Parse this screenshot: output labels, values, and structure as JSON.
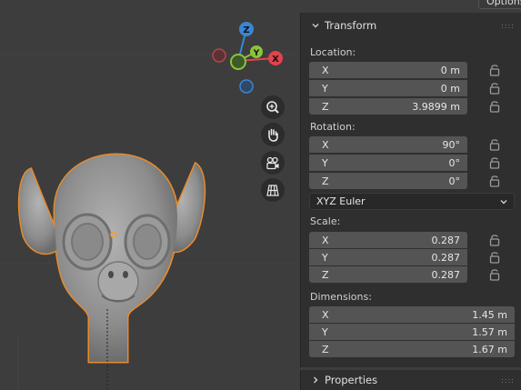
{
  "toolbar": {
    "options_label": "Options"
  },
  "gizmo": {
    "z_label": "Z",
    "y_label": "Y",
    "x_label": "X"
  },
  "viewport_tools": [
    {
      "name": "zoom-icon"
    },
    {
      "name": "hand-pan-icon"
    },
    {
      "name": "camera-icon"
    },
    {
      "name": "ortho-grid-icon"
    }
  ],
  "transform": {
    "title": "Transform",
    "location": {
      "label": "Location:",
      "fields": [
        {
          "axis": "X",
          "value": "0 m"
        },
        {
          "axis": "Y",
          "value": "0 m"
        },
        {
          "axis": "Z",
          "value": "3.9899 m"
        }
      ]
    },
    "rotation": {
      "label": "Rotation:",
      "fields": [
        {
          "axis": "X",
          "value": "90°"
        },
        {
          "axis": "Y",
          "value": "0°"
        },
        {
          "axis": "Z",
          "value": "0°"
        }
      ],
      "mode": "XYZ Euler"
    },
    "scale": {
      "label": "Scale:",
      "fields": [
        {
          "axis": "X",
          "value": "0.287"
        },
        {
          "axis": "Y",
          "value": "0.287"
        },
        {
          "axis": "Z",
          "value": "0.287"
        }
      ]
    },
    "dimensions": {
      "label": "Dimensions:",
      "fields": [
        {
          "axis": "X",
          "value": "1.45 m"
        },
        {
          "axis": "Y",
          "value": "1.57 m"
        },
        {
          "axis": "Z",
          "value": "1.67 m"
        }
      ]
    }
  },
  "properties": {
    "title": "Properties"
  },
  "colors": {
    "x_axis": "#e2434b",
    "y_axis": "#8bc33a",
    "z_axis": "#3a86d6",
    "selection": "#e88b2b"
  }
}
